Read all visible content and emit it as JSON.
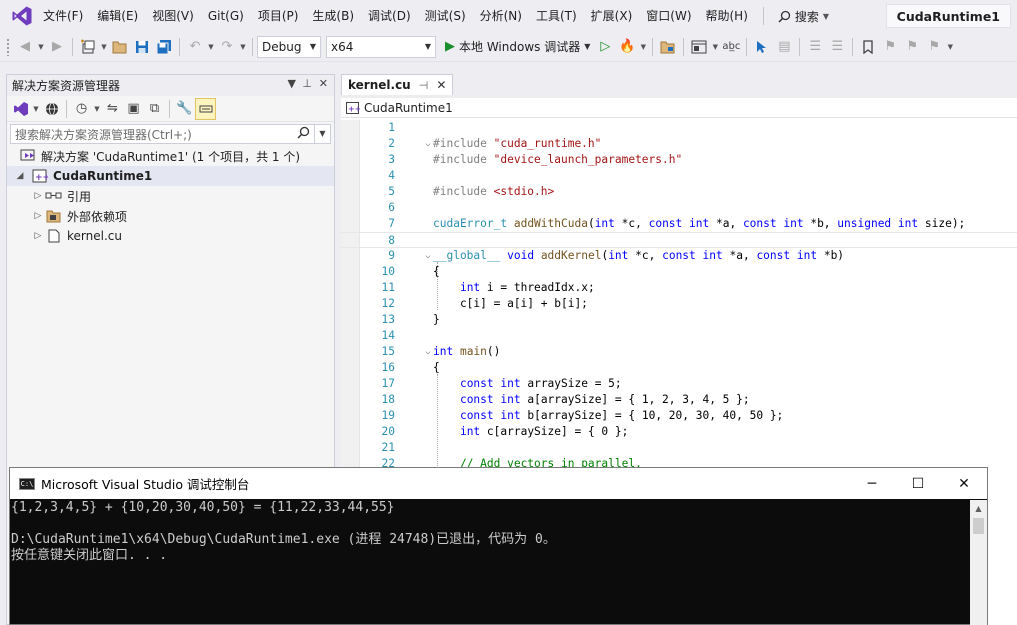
{
  "menubar": {
    "items": [
      "文件(F)",
      "编辑(E)",
      "视图(V)",
      "Git(G)",
      "项目(P)",
      "生成(B)",
      "调试(D)",
      "测试(S)",
      "分析(N)",
      "工具(T)",
      "扩展(X)",
      "窗口(W)",
      "帮助(H)"
    ],
    "search_label": "搜索",
    "project_title": "CudaRuntime1"
  },
  "toolbar": {
    "config": "Debug",
    "platform": "x64",
    "run_label": "本地 Windows 调试器"
  },
  "solution_explorer": {
    "title": "解决方案资源管理器",
    "search_placeholder": "搜索解决方案资源管理器(Ctrl+;)",
    "solution_label": "解决方案 'CudaRuntime1' (1 个项目，共 1 个)",
    "project_label": "CudaRuntime1",
    "items": [
      "引用",
      "外部依赖项",
      "kernel.cu"
    ]
  },
  "editor": {
    "tab_name": "kernel.cu",
    "nav_scope": "CudaRuntime1",
    "lines": [
      {
        "n": "1",
        "t": []
      },
      {
        "n": "2",
        "fold": "⌵",
        "t": [
          [
            "pp",
            "#include "
          ],
          [
            "str",
            "\"cuda_runtime.h\""
          ]
        ]
      },
      {
        "n": "3",
        "t": [
          [
            "pp",
            "#include "
          ],
          [
            "str",
            "\"device_launch_parameters.h\""
          ]
        ]
      },
      {
        "n": "4",
        "t": []
      },
      {
        "n": "5",
        "t": [
          [
            "pp",
            "#include "
          ],
          [
            "str",
            "<stdio.h>"
          ]
        ]
      },
      {
        "n": "6",
        "t": []
      },
      {
        "n": "7",
        "t": [
          [
            "ty",
            "cudaError_t"
          ],
          [
            "nm",
            " "
          ],
          [
            "fn",
            "addWithCuda"
          ],
          [
            "nm",
            "("
          ],
          [
            "kw",
            "int"
          ],
          [
            "nm",
            " *c, "
          ],
          [
            "kw",
            "const"
          ],
          [
            "nm",
            " "
          ],
          [
            "kw",
            "int"
          ],
          [
            "nm",
            " *a, "
          ],
          [
            "kw",
            "const"
          ],
          [
            "nm",
            " "
          ],
          [
            "kw",
            "int"
          ],
          [
            "nm",
            " *b, "
          ],
          [
            "kw",
            "unsigned"
          ],
          [
            "nm",
            " "
          ],
          [
            "kw",
            "int"
          ],
          [
            "nm",
            " size);"
          ]
        ]
      },
      {
        "n": "8",
        "t": [],
        "current": true
      },
      {
        "n": "9",
        "fold": "⌵",
        "t": [
          [
            "ty",
            "__global__"
          ],
          [
            "nm",
            " "
          ],
          [
            "kw",
            "void"
          ],
          [
            "nm",
            " "
          ],
          [
            "fn",
            "addKernel"
          ],
          [
            "nm",
            "("
          ],
          [
            "kw",
            "int"
          ],
          [
            "nm",
            " *c, "
          ],
          [
            "kw",
            "const"
          ],
          [
            "nm",
            " "
          ],
          [
            "kw",
            "int"
          ],
          [
            "nm",
            " *a, "
          ],
          [
            "kw",
            "const"
          ],
          [
            "nm",
            " "
          ],
          [
            "kw",
            "int"
          ],
          [
            "nm",
            " *b)"
          ]
        ]
      },
      {
        "n": "10",
        "t": [
          [
            "nm",
            "{"
          ]
        ]
      },
      {
        "n": "11",
        "t": [
          [
            "nm",
            "    "
          ],
          [
            "kw",
            "int"
          ],
          [
            "nm",
            " i = threadIdx.x;"
          ]
        ]
      },
      {
        "n": "12",
        "t": [
          [
            "nm",
            "    c[i] = a[i] + b[i];"
          ]
        ]
      },
      {
        "n": "13",
        "t": [
          [
            "nm",
            "}"
          ]
        ]
      },
      {
        "n": "14",
        "t": []
      },
      {
        "n": "15",
        "fold": "⌵",
        "t": [
          [
            "kw",
            "int"
          ],
          [
            "nm",
            " "
          ],
          [
            "fn",
            "main"
          ],
          [
            "nm",
            "()"
          ]
        ]
      },
      {
        "n": "16",
        "t": [
          [
            "nm",
            "{"
          ]
        ]
      },
      {
        "n": "17",
        "t": [
          [
            "nm",
            "    "
          ],
          [
            "kw",
            "const"
          ],
          [
            "nm",
            " "
          ],
          [
            "kw",
            "int"
          ],
          [
            "nm",
            " arraySize = 5;"
          ]
        ]
      },
      {
        "n": "18",
        "t": [
          [
            "nm",
            "    "
          ],
          [
            "kw",
            "const"
          ],
          [
            "nm",
            " "
          ],
          [
            "kw",
            "int"
          ],
          [
            "nm",
            " a[arraySize] = { 1, 2, 3, 4, 5 };"
          ]
        ]
      },
      {
        "n": "19",
        "t": [
          [
            "nm",
            "    "
          ],
          [
            "kw",
            "const"
          ],
          [
            "nm",
            " "
          ],
          [
            "kw",
            "int"
          ],
          [
            "nm",
            " b[arraySize] = { 10, 20, 30, 40, 50 };"
          ]
        ]
      },
      {
        "n": "20",
        "t": [
          [
            "nm",
            "    "
          ],
          [
            "kw",
            "int"
          ],
          [
            "nm",
            " c[arraySize] = { 0 };"
          ]
        ]
      },
      {
        "n": "21",
        "t": []
      },
      {
        "n": "22",
        "t": [
          [
            "nm",
            "    "
          ],
          [
            "cm",
            "// Add vectors in parallel."
          ]
        ]
      }
    ]
  },
  "console": {
    "title": "Microsoft Visual Studio 调试控制台",
    "output": "{1,2,3,4,5} + {10,20,30,40,50} = {11,22,33,44,55}\n\nD:\\CudaRuntime1\\x64\\Debug\\CudaRuntime1.exe (进程 24748)已退出，代码为 0。\n按任意键关闭此窗口. . ."
  }
}
